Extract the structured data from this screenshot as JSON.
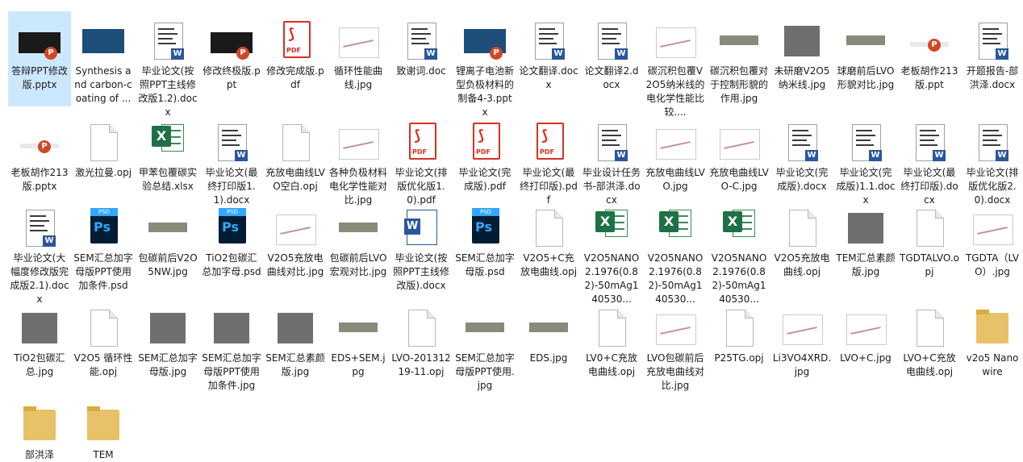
{
  "items": [
    {
      "label": "答辩PPT修改版.pptx",
      "kind": "pptx",
      "selected": true
    },
    {
      "label": "Synthesis and carbon-coating of ...",
      "kind": "blueimg"
    },
    {
      "label": "毕业论文(按照PPT主线修改版1.2).docx",
      "kind": "docx"
    },
    {
      "label": "修改终极版.ppt",
      "kind": "pptx"
    },
    {
      "label": "修改完成版.pdf",
      "kind": "pdf"
    },
    {
      "label": "循环性能曲线.jpg",
      "kind": "chart"
    },
    {
      "label": "致谢词.doc",
      "kind": "docx"
    },
    {
      "label": "锂离子电池新型负极材料的制备4-3.pptx",
      "kind": "pptx-blue"
    },
    {
      "label": "论文翻译.docx",
      "kind": "docx"
    },
    {
      "label": "论文翻译2.docx",
      "kind": "docx"
    },
    {
      "label": "碳沉积包覆V2O5纳米线的电化学性能比较....",
      "kind": "chart"
    },
    {
      "label": "碳沉积包覆对于控制形貌的作用.jpg",
      "kind": "strip"
    },
    {
      "label": "未研磨V2O5纳米线.jpg",
      "kind": "gray"
    },
    {
      "label": "球磨前后LVO形貌对比.jpg",
      "kind": "strip"
    },
    {
      "label": "老板胡作213版.ppt",
      "kind": "pptx-small"
    },
    {
      "label": "开题报告-部洪泽.docx",
      "kind": "docx"
    },
    {
      "label": "老板胡作213版.pptx",
      "kind": "pptx-small"
    },
    {
      "label": "激光拉曼.opj",
      "kind": "blank"
    },
    {
      "label": "甲苯包覆碳实验总结.xlsx",
      "kind": "xlsx"
    },
    {
      "label": "毕业论文(最终打印版1.1).docx",
      "kind": "docx"
    },
    {
      "label": "充放电曲线LVO空白.opj",
      "kind": "blank"
    },
    {
      "label": "各种负极材料电化学性能对比.jpg",
      "kind": "chart"
    },
    {
      "label": "毕业论文(排版优化版1.0).pdf",
      "kind": "pdf"
    },
    {
      "label": "毕业论文(完成版).pdf",
      "kind": "pdf"
    },
    {
      "label": "毕业论文(最终打印版).pdf",
      "kind": "pdf"
    },
    {
      "label": "毕业设计任务书-部洪泽.docx",
      "kind": "docx"
    },
    {
      "label": "充放电曲线LVO.jpg",
      "kind": "chart"
    },
    {
      "label": "充放电曲线LVO-C.jpg",
      "kind": "chart"
    },
    {
      "label": "毕业论文(完成版).docx",
      "kind": "docx"
    },
    {
      "label": "毕业论文(完成版)1.1.docx",
      "kind": "docx"
    },
    {
      "label": "毕业论文(最终打印版).docx",
      "kind": "docx"
    },
    {
      "label": "毕业论文(排版优化版2.0).docx",
      "kind": "docx"
    },
    {
      "label": "毕业论文(大幅度修改版完成版2.1).docx",
      "kind": "docx"
    },
    {
      "label": "SEM汇总加字母版PPT使用加条件.psd",
      "kind": "psd"
    },
    {
      "label": "包碳前后V2O5NW.jpg",
      "kind": "strip"
    },
    {
      "label": "TiO2包碳汇总加字母.psd",
      "kind": "psd"
    },
    {
      "label": "V2O5充放电曲线对比.jpg",
      "kind": "chart"
    },
    {
      "label": "包碳前后LVO宏观对比.jpg",
      "kind": "strip"
    },
    {
      "label": "毕业论文(按照PPT主线修改版).docx",
      "kind": "wordbig"
    },
    {
      "label": "SEM汇总加字母版.psd",
      "kind": "psd"
    },
    {
      "label": "V2O5+C充放电曲线.opj",
      "kind": "blank"
    },
    {
      "label": "V2O5NANO2.1976(0.82)-50mAg140530...",
      "kind": "xlsx"
    },
    {
      "label": "V2O5NANO2.1976(0.82)-50mAg140530...",
      "kind": "xlsx"
    },
    {
      "label": "V2O5NANO2.1976(0.82)-50mAg140530...",
      "kind": "xlsx"
    },
    {
      "label": "V2O5充放电曲线.opj",
      "kind": "blank"
    },
    {
      "label": "TEM汇总素颜版.jpg",
      "kind": "gray"
    },
    {
      "label": "TGDTALVO.opj",
      "kind": "blank"
    },
    {
      "label": "TGDTA（LVO）.jpg",
      "kind": "chart"
    },
    {
      "label": "TiO2包碳汇总.jpg",
      "kind": "gray"
    },
    {
      "label": "V2O5 循环性能.opj",
      "kind": "blank"
    },
    {
      "label": "SEM汇总加字母版.jpg",
      "kind": "gray"
    },
    {
      "label": "SEM汇总加字母版PPT使用加条件.jpg",
      "kind": "gray"
    },
    {
      "label": "SEM汇总素颜版.jpg",
      "kind": "gray"
    },
    {
      "label": "EDS+SEM.jpg",
      "kind": "strip"
    },
    {
      "label": "LVO-20131219-11.opj",
      "kind": "blank"
    },
    {
      "label": "SEM汇总加字母版PPT使用.jpg",
      "kind": "strip"
    },
    {
      "label": "EDS.jpg",
      "kind": "strip"
    },
    {
      "label": "LV0+C充放电曲线.opj",
      "kind": "blank"
    },
    {
      "label": "LVO包碳前后充放电曲线对比.jpg",
      "kind": "chart"
    },
    {
      "label": "P25TG.opj",
      "kind": "blank"
    },
    {
      "label": "Li3VO4XRD.jpg",
      "kind": "chart"
    },
    {
      "label": "LVO+C.jpg",
      "kind": "chart"
    },
    {
      "label": "LVO+C充放电曲线.opj",
      "kind": "blank"
    },
    {
      "label": "v2o5 Nanowire",
      "kind": "folder"
    },
    {
      "label": "部洪泽",
      "kind": "folder"
    },
    {
      "label": "TEM",
      "kind": "folder"
    }
  ]
}
